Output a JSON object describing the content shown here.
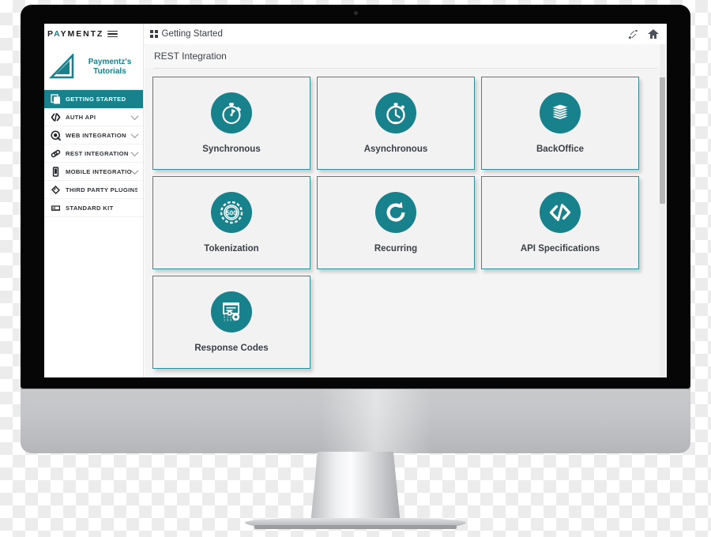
{
  "brand": {
    "wordmark_pre": "P",
    "wordmark_hl": "A",
    "wordmark_post": "YMENTZ",
    "menu_icon": "hamburger-icon",
    "logo_title_line1": "Paymentz's",
    "logo_title_line2": "Tutorials",
    "logo_icon": "set-square-triangle-icon"
  },
  "topbar": {
    "tab_icon": "grid-2x2-icon",
    "tab_label": "Getting Started",
    "expand_icon": "expand-arrow-icon",
    "home_icon": "home-icon"
  },
  "sidebar": {
    "items": [
      {
        "label": "GETTING STARTED",
        "icon": "copy-pages-icon",
        "active": true,
        "has_chevron": false
      },
      {
        "label": "AUTH API",
        "icon": "code-brackets-icon",
        "active": false,
        "has_chevron": true
      },
      {
        "label": "WEB INTEGRATION",
        "icon": "headset-icon",
        "active": false,
        "has_chevron": true
      },
      {
        "label": "REST INTEGRATION",
        "icon": "link-chain-icon",
        "active": false,
        "has_chevron": true
      },
      {
        "label": "MOBILE INTEGRATION",
        "icon": "mobile-phone-icon",
        "active": false,
        "has_chevron": true
      },
      {
        "label": "THIRD PARTY PLUGINS",
        "icon": "puzzle-plug-icon",
        "active": false,
        "has_chevron": false
      },
      {
        "label": "STANDARD KIT",
        "icon": "keyboard-icon",
        "active": false,
        "has_chevron": false
      }
    ]
  },
  "main": {
    "page_title": "REST Integration",
    "cards": [
      {
        "label": "Synchronous",
        "icon": "stopwatch-icon"
      },
      {
        "label": "Asynchronous",
        "icon": "alarm-clock-icon"
      },
      {
        "label": "BackOffice",
        "icon": "paper-stack-icon"
      },
      {
        "label": "Tokenization",
        "icon": "poker-chip-icon",
        "chip_value": "500"
      },
      {
        "label": "Recurring",
        "icon": "refresh-circle-icon"
      },
      {
        "label": "API Specifications",
        "icon": "code-angle-brackets-icon"
      },
      {
        "label": "Response Codes",
        "icon": "document-gears-icon"
      }
    ]
  },
  "colors": {
    "accent_teal": "#17818c",
    "card_border": "#2b8f99",
    "card_bg": "#f2f2f2",
    "content_bg": "#f4f4f4",
    "text_dark": "#3a3f47"
  }
}
